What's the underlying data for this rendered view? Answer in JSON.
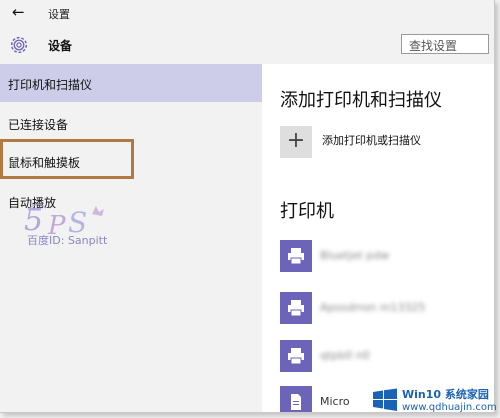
{
  "titlebar": {
    "back_icon": "←",
    "app_title": "设置"
  },
  "header": {
    "icon": "gear-icon",
    "title": "设备",
    "search_placeholder": "查找设置"
  },
  "sidebar": {
    "items": [
      {
        "label": "打印机和扫描仪",
        "selected": true
      },
      {
        "label": "已连接设备",
        "selected": false
      },
      {
        "label": "鼠标和触摸板",
        "selected": false,
        "highlighted": true
      },
      {
        "label": "自动播放",
        "selected": false
      }
    ]
  },
  "watermark": {
    "text": "百度ID: Sanpitt"
  },
  "content": {
    "section_title": "添加打印机和扫描仪",
    "add_label": "添加打印机或扫描仪",
    "printers_title": "打印机",
    "printers": [
      {
        "name": "Bluetjet pdw",
        "blurred": true
      },
      {
        "name": "Aposdrron m13325",
        "blurred": true
      },
      {
        "name": "qtpb0 n0",
        "blurred": true
      },
      {
        "name": "Micro",
        "blurred": false
      }
    ]
  },
  "corner_logo": {
    "line1": "Win10 系统家园",
    "line2": "www.qdhuajin.com"
  },
  "colors": {
    "accent": "#6c64b8",
    "selected_bg": "#cdcdea",
    "highlight_border": "#b1783f",
    "sidebar_bg": "#f2f2f2"
  }
}
